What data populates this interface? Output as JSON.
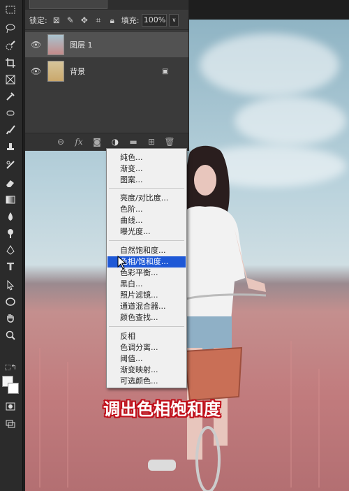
{
  "layers_panel": {
    "lock_label": "锁定:",
    "fill_label": "填充:",
    "fill_value": "100%",
    "layers": [
      {
        "name": "图层 1",
        "selected": true
      },
      {
        "name": "背景",
        "selected": false
      }
    ]
  },
  "adjustment_menu": {
    "groups": [
      [
        "纯色...",
        "渐变...",
        "图案..."
      ],
      [
        "亮度/对比度...",
        "色阶...",
        "曲线...",
        "曝光度..."
      ],
      [
        "自然饱和度...",
        "色相/饱和度...",
        "色彩平衡...",
        "黑白...",
        "照片滤镜...",
        "通道混合器...",
        "颜色查找..."
      ],
      [
        "反相",
        "色调分离...",
        "阈值...",
        "渐变映射...",
        "可选颜色..."
      ]
    ],
    "highlighted": "色相/饱和度..."
  },
  "caption": "调出色相饱和度",
  "colors": {
    "highlight": "#1e58d6",
    "caption_stroke": "#c0101b"
  }
}
